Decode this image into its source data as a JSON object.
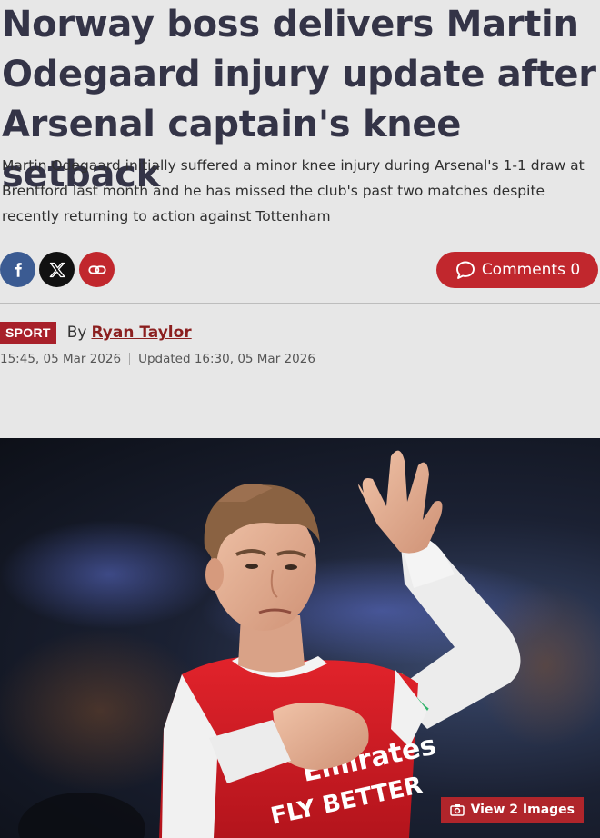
{
  "article": {
    "headline": "Norway boss delivers Martin Odegaard injury update after Arsenal captain's knee setback",
    "standfirst": "Martin Odegaard initially suffered a minor knee injury during Arsenal's 1-1 draw at Brentford last month and he has missed the club's past two matches despite recently returning to action against Tottenham",
    "section": "SPORT",
    "by_label": "By",
    "author": "Ryan Taylor",
    "published": "15:45, 05 Mar 2026",
    "updated": "Updated 16:30, 05 Mar 2026"
  },
  "share": {
    "icons": [
      "facebook-icon",
      "x-icon",
      "link-icon"
    ]
  },
  "comments": {
    "label": "Comments 0",
    "icon": "speech-bubble-icon"
  },
  "hero": {
    "view_images_label": "View 2 Images",
    "icon": "camera-icon",
    "shirt_text_top": "Emirates",
    "shirt_text_bottom": "FLY BETTER"
  },
  "colors": {
    "accent_red": "#c1272d",
    "badge_red": "#a8202a",
    "headline": "#343447",
    "background": "#e7e7e7"
  }
}
